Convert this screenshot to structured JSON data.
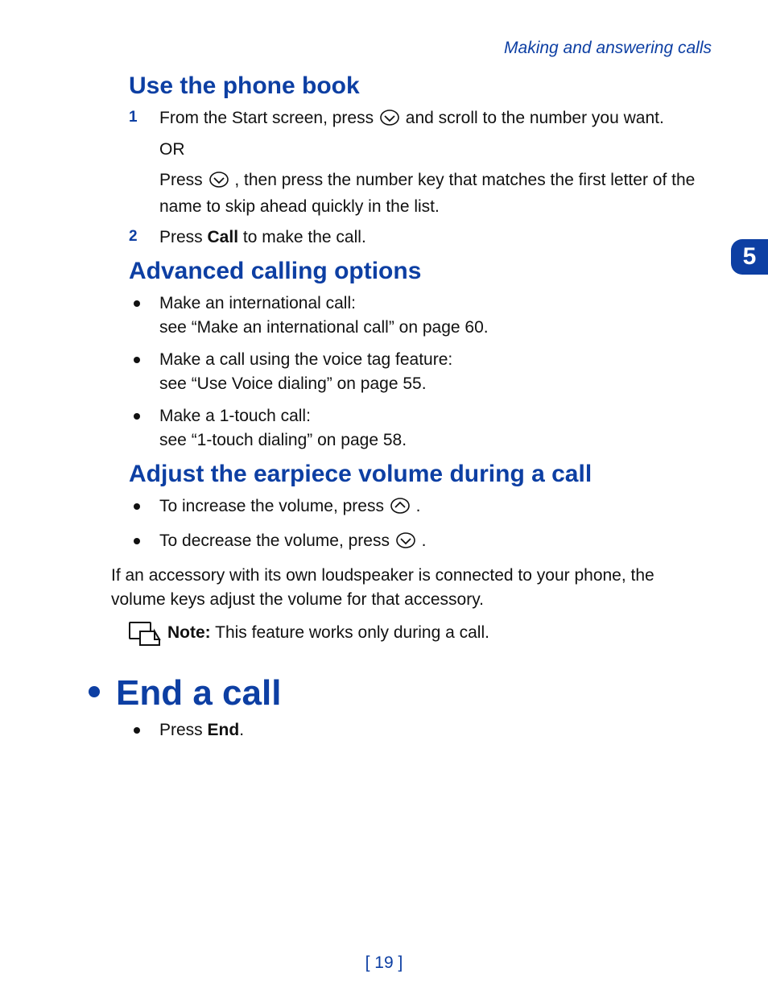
{
  "running_head": "Making and answering calls",
  "chapter_tab": "5",
  "folio": "[ 19 ]",
  "sec_phonebook": {
    "title": "Use the phone book",
    "steps": {
      "s1": {
        "num": "1",
        "line1_a": "From the Start screen, press ",
        "line1_b": " and scroll to the number you want.",
        "or": "OR",
        "line2_a": "Press ",
        "line2_b": " , then press the number key that matches the first letter of the name to skip ahead quickly in the list."
      },
      "s2": {
        "num": "2",
        "a": "Press ",
        "b": "Call",
        "c": " to make the call."
      }
    }
  },
  "sec_advanced": {
    "title": "Advanced calling options",
    "items": [
      {
        "l1": "Make an international call:",
        "l2": "see “Make an international call” on page 60."
      },
      {
        "l1": "Make a call using the voice tag feature:",
        "l2": "see “Use Voice dialing” on page 55."
      },
      {
        "l1": "Make a 1-touch call:",
        "l2": "see “1-touch dialing” on page 58."
      }
    ]
  },
  "sec_volume": {
    "title": "Adjust the earpiece volume during a call",
    "inc_a": "To increase the volume, press ",
    "inc_b": " .",
    "dec_a": "To decrease the volume, press ",
    "dec_b": " .",
    "para": "If an accessory with its own loudspeaker is connected to your phone, the volume keys adjust the volume for that accessory.",
    "note_label": "Note:",
    "note_body": " This feature works only during a call."
  },
  "sec_end": {
    "title": "End a call",
    "item_a": "Press ",
    "item_b": "End",
    "item_c": "."
  }
}
